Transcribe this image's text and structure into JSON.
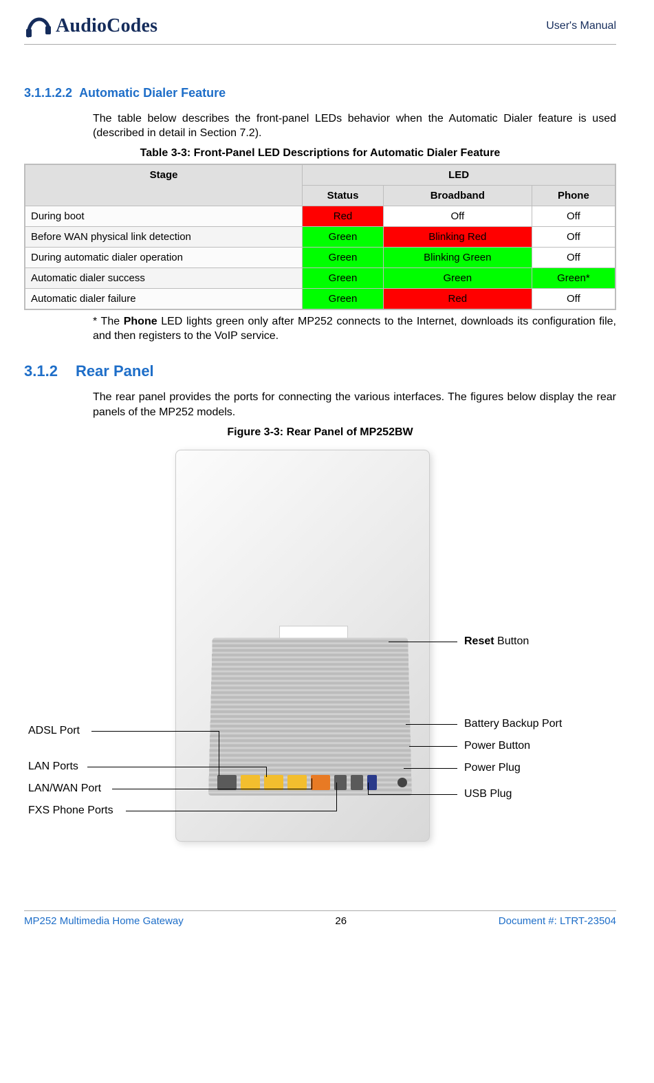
{
  "header": {
    "brand": "AudioCodes",
    "right": "User's Manual"
  },
  "section311": {
    "num": "3.1.1.2.2",
    "title": "Automatic Dialer Feature",
    "intro": "The table below describes the front-panel LEDs behavior when the Automatic Dialer feature is used (described in detail in Section 7.2)."
  },
  "table": {
    "caption": "Table 3-3: Front-Panel LED Descriptions for Automatic Dialer Feature",
    "head": {
      "stage": "Stage",
      "led": "LED",
      "status": "Status",
      "broadband": "Broadband",
      "phone": "Phone"
    },
    "rows": [
      {
        "stage": "During boot",
        "status": {
          "t": "Red",
          "c": "red"
        },
        "broadband": {
          "t": "Off",
          "c": ""
        },
        "phone": {
          "t": "Off",
          "c": ""
        }
      },
      {
        "stage": "Before WAN physical link detection",
        "status": {
          "t": "Green",
          "c": "green"
        },
        "broadband": {
          "t": "Blinking Red",
          "c": "red"
        },
        "phone": {
          "t": "Off",
          "c": ""
        }
      },
      {
        "stage": "During automatic dialer operation",
        "status": {
          "t": "Green",
          "c": "green"
        },
        "broadband": {
          "t": "Blinking Green",
          "c": "green"
        },
        "phone": {
          "t": "Off",
          "c": ""
        }
      },
      {
        "stage": "Automatic dialer success",
        "status": {
          "t": "Green",
          "c": "green"
        },
        "broadband": {
          "t": "Green",
          "c": "green"
        },
        "phone": {
          "t": "Green*",
          "c": "green"
        }
      },
      {
        "stage": "Automatic dialer failure",
        "status": {
          "t": "Green",
          "c": "green"
        },
        "broadband": {
          "t": "Red",
          "c": "red"
        },
        "phone": {
          "t": "Off",
          "c": ""
        }
      }
    ]
  },
  "footnote": {
    "lead": "* The ",
    "bold": "Phone",
    "rest": " LED lights green only after MP252 connects to the Internet, downloads its configuration file, and then registers to the VoIP service."
  },
  "section312": {
    "num": "3.1.2",
    "title": "Rear Panel",
    "intro": "The rear panel provides the ports for connecting the various interfaces. The figures below display the rear panels of the MP252 models.",
    "fig_caption": "Figure 3-3:  Rear Panel of MP252BW"
  },
  "callouts": {
    "reset_bold": "Reset",
    "reset_rest": " Button",
    "battery": "Battery Backup Port",
    "power_button": "Power Button",
    "power_plug": "Power Plug",
    "usb_plug": "USB Plug",
    "adsl": "ADSL Port",
    "lan": "LAN Ports",
    "lanwan": "LAN/WAN Port",
    "fxs": "FXS Phone Ports"
  },
  "footer": {
    "left": "MP252 Multimedia Home Gateway",
    "mid": "26",
    "right": "Document #: LTRT-23504"
  }
}
